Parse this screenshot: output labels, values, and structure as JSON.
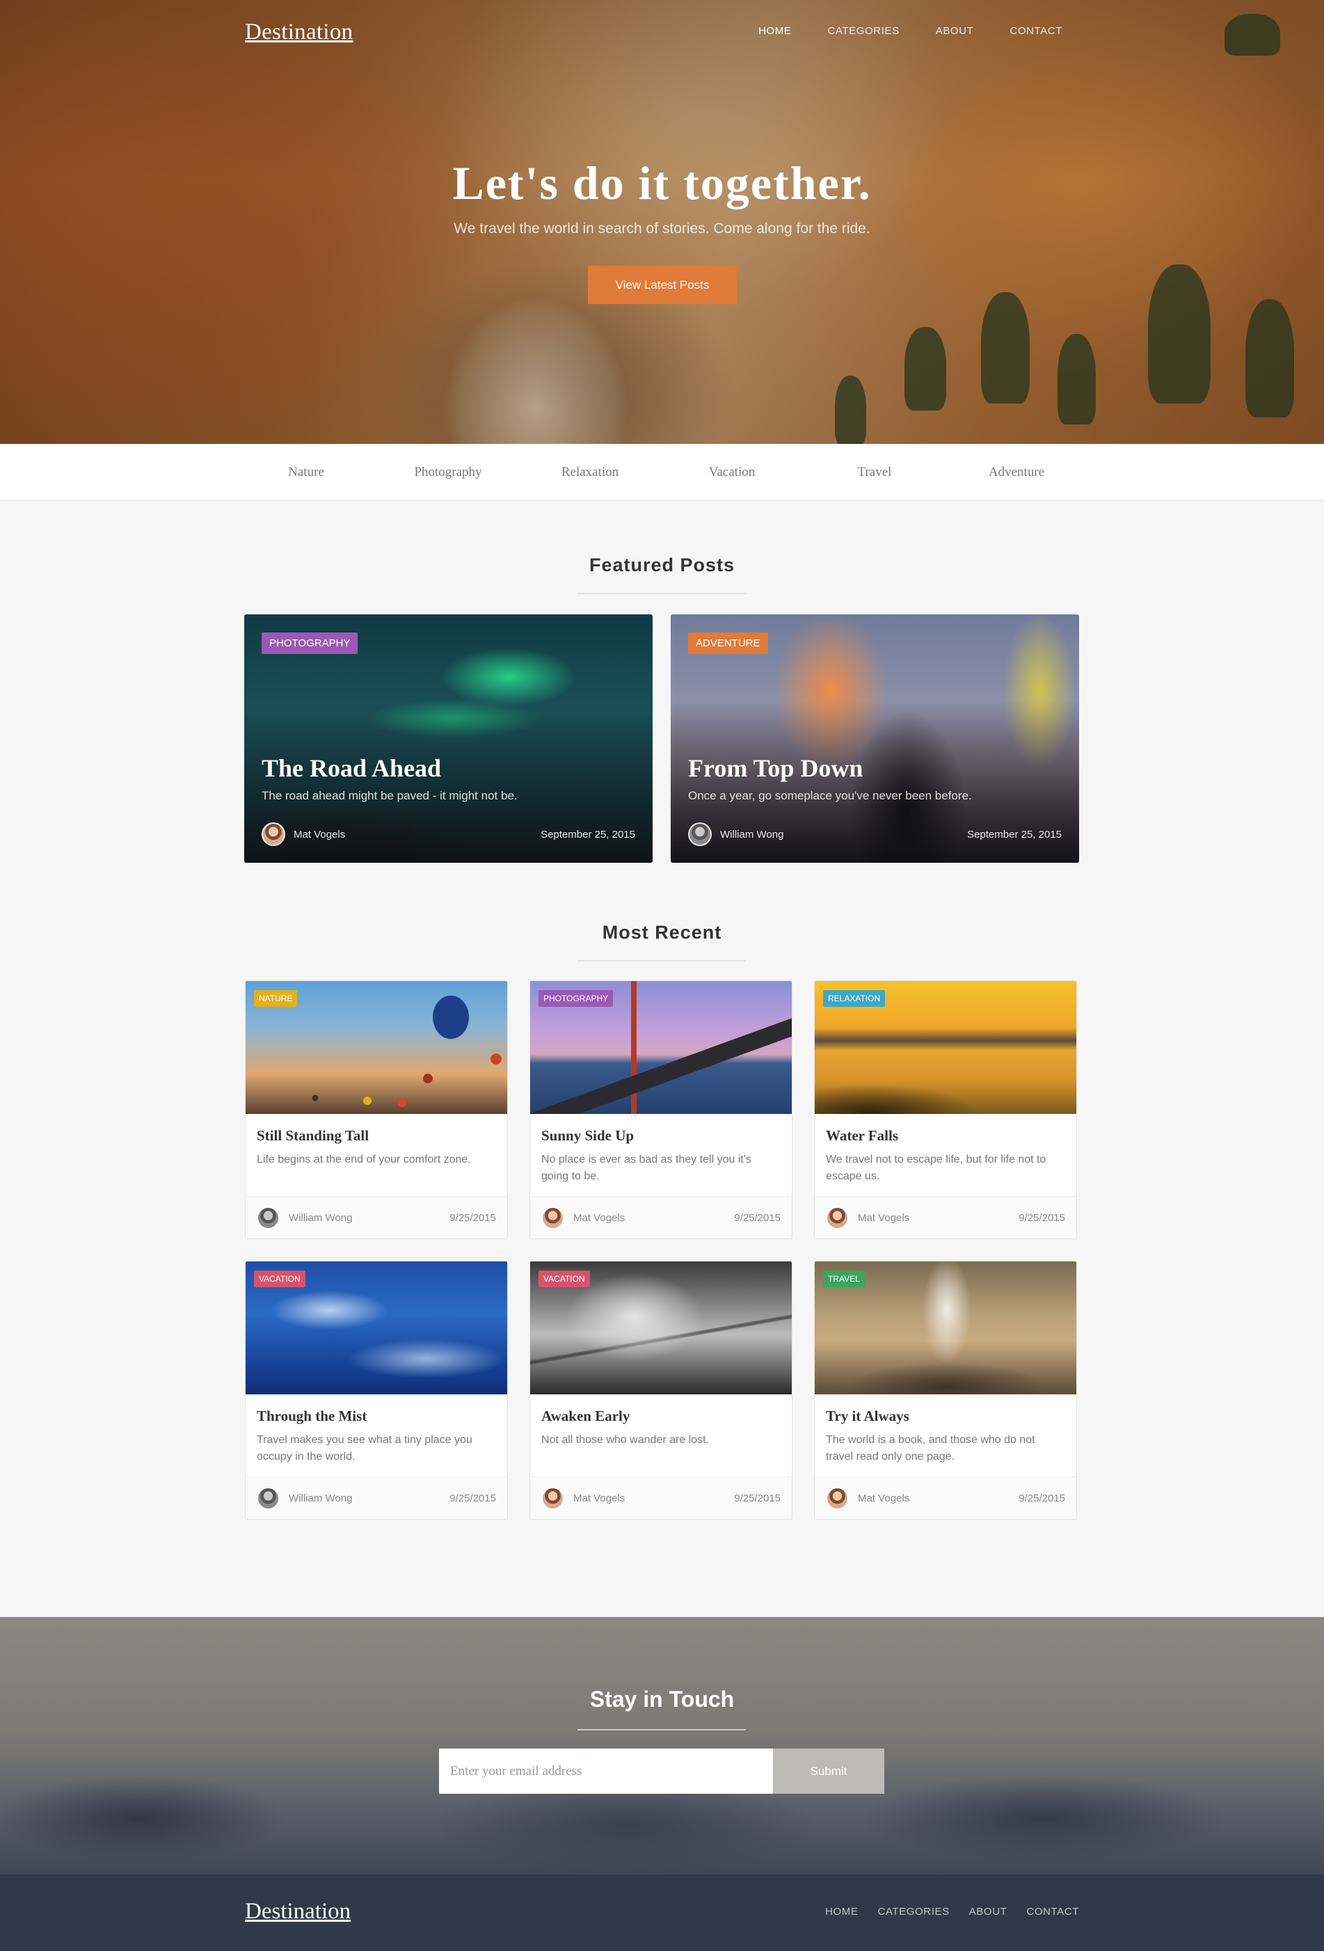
{
  "brand": "Destination",
  "nav": {
    "items": [
      {
        "label": "HOME",
        "active": true
      },
      {
        "label": "CATEGORIES",
        "active": false
      },
      {
        "label": "ABOUT",
        "active": false
      },
      {
        "label": "CONTACT",
        "active": false
      }
    ]
  },
  "hero": {
    "title": "Let's do it together.",
    "subtitle": "We travel the world in search of stories. Come along for the ride.",
    "button_label": "View Latest Posts"
  },
  "categories": [
    "Nature",
    "Photography",
    "Relaxation",
    "Vacation",
    "Travel",
    "Adventure"
  ],
  "featured": {
    "heading": "Featured Posts",
    "posts": [
      {
        "badge": "PHOTOGRAPHY",
        "badge_color": "#9b59b6",
        "title": "The Road Ahead",
        "subtitle": "The road ahead might be paved - it might not be.",
        "author": "Mat Vogels",
        "date": "September 25, 2015"
      },
      {
        "badge": "ADVENTURE",
        "badge_color": "#e07b39",
        "title": "From Top Down",
        "subtitle": "Once a year, go someplace you've never been before.",
        "author": "William Wong",
        "date": "September 25, 2015"
      }
    ]
  },
  "recent": {
    "heading": "Most Recent",
    "posts": [
      {
        "badge": "NATURE",
        "badge_color": "#e4b020",
        "title": "Still Standing Tall",
        "description": "Life begins at the end of your comfort zone.",
        "author": "William Wong",
        "date": "9/25/2015"
      },
      {
        "badge": "PHOTOGRAPHY",
        "badge_color": "#9b59b6",
        "title": "Sunny Side Up",
        "description": "No place is ever as bad as they tell you it's going to be.",
        "author": "Mat Vogels",
        "date": "9/25/2015"
      },
      {
        "badge": "RELAXATION",
        "badge_color": "#3fa7c4",
        "title": "Water Falls",
        "description": "We travel not to escape life, but for life not to escape us.",
        "author": "Mat Vogels",
        "date": "9/25/2015"
      },
      {
        "badge": "VACATION",
        "badge_color": "#d6536d",
        "title": "Through the Mist",
        "description": "Travel makes you see what a tiny place you occupy in the world.",
        "author": "William Wong",
        "date": "9/25/2015"
      },
      {
        "badge": "VACATION",
        "badge_color": "#d6536d",
        "title": "Awaken Early",
        "description": "Not all those who wander are lost.",
        "author": "Mat Vogels",
        "date": "9/25/2015"
      },
      {
        "badge": "TRAVEL",
        "badge_color": "#3aa65a",
        "title": "Try it Always",
        "description": "The world is a book, and those who do not travel read only one page.",
        "author": "Mat Vogels",
        "date": "9/25/2015"
      }
    ]
  },
  "newsletter": {
    "heading": "Stay in Touch",
    "input_placeholder": "Enter your email address",
    "button_label": "Submit"
  },
  "footer": {
    "brand": "Destination",
    "links": [
      "HOME",
      "CATEGORIES",
      "ABOUT",
      "CONTACT"
    ]
  },
  "colors": {
    "accent": "#e07b39",
    "footer_bg": "#2f3a48"
  }
}
